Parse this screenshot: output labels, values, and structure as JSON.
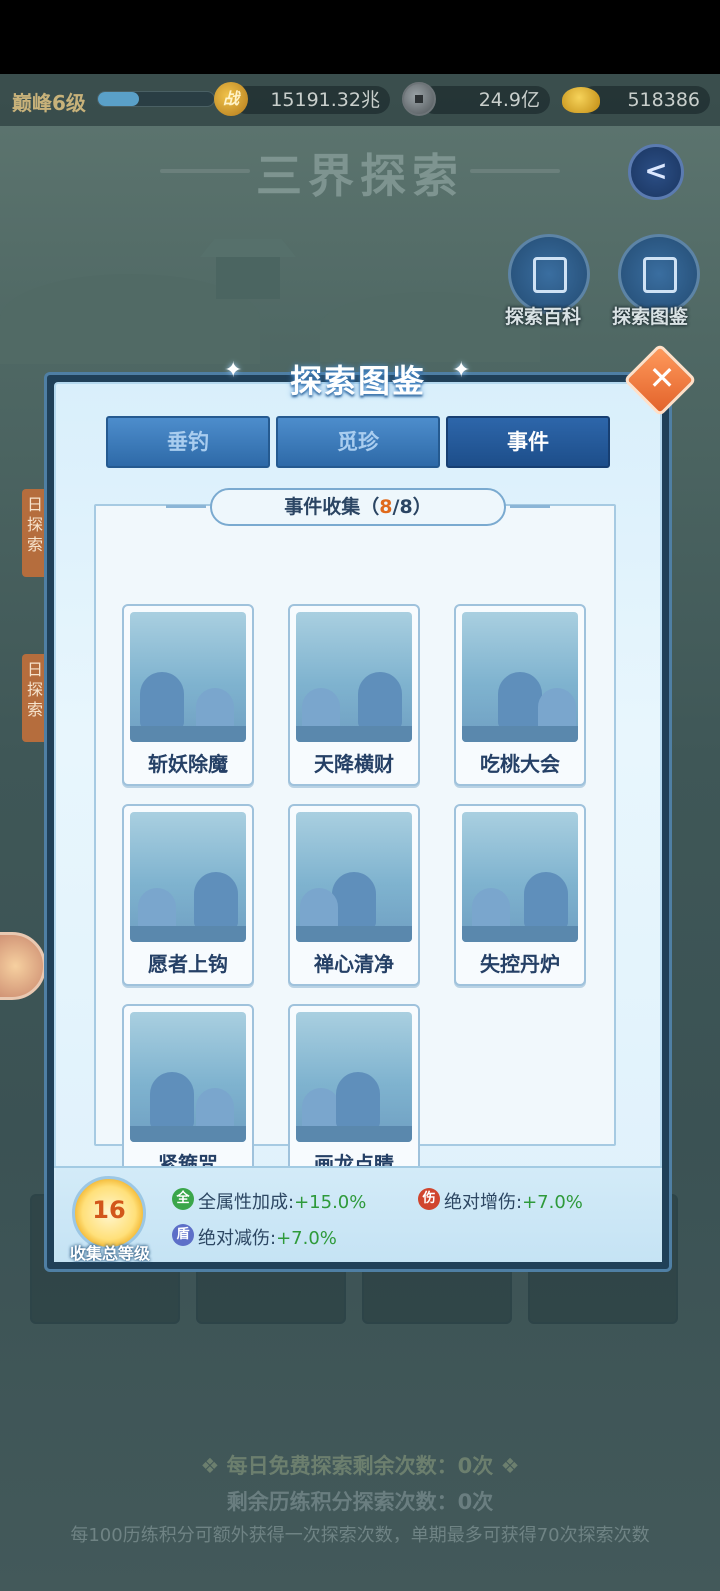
{
  "resources": {
    "level": "巅峰6级",
    "xp_fraction": 0.35,
    "power": "15191.32兆",
    "silver": "24.9亿",
    "gold": "518386"
  },
  "scene": {
    "title": "三界探索",
    "side_buttons": [
      "探索百科",
      "探索图鉴"
    ],
    "bg_tabs": [
      "日探索",
      "日探索"
    ]
  },
  "modal": {
    "title": "探索图鉴",
    "tabs": [
      "垂钓",
      "觅珍",
      "事件"
    ],
    "active_tab": "事件",
    "collection": {
      "label": "事件收集（",
      "collected": "8",
      "sep": "/8）"
    },
    "cards": [
      {
        "name": "斩妖除魔"
      },
      {
        "name": "天降横财"
      },
      {
        "name": "吃桃大会"
      },
      {
        "name": "愿者上钩"
      },
      {
        "name": "禅心清净"
      },
      {
        "name": "失控丹炉"
      },
      {
        "name": "紧箍咒"
      },
      {
        "name": "画龙点睛"
      }
    ],
    "footer": {
      "level": "16",
      "level_label": "收集总等级",
      "attr1_label": "全属性加成:",
      "attr1_value": "+15.0%",
      "attr2_label": "绝对增伤:",
      "attr2_value": "+7.0%",
      "attr3_label": "绝对减伤:",
      "attr3_value": "+7.0%"
    }
  },
  "bottom": {
    "free_count": "❖ 每日免费探索剩余次数：0次 ❖",
    "remain_count": "剩余历练积分探索次数：0次",
    "rule": "每100历练积分可额外获得一次探索次数，单期最多可获得70次探索次数"
  },
  "colors": {
    "accent_blue": "#2e6aa8",
    "highlight_orange": "#e06a1c",
    "bonus_green": "#2e9a3a"
  }
}
